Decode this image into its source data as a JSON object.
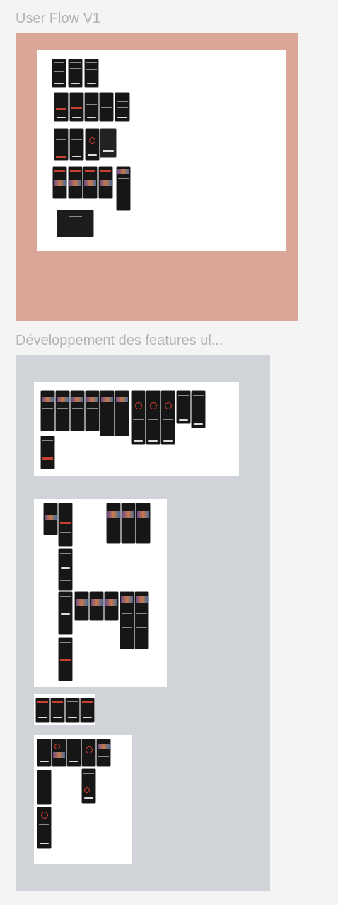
{
  "sections": [
    {
      "id": "user-flow",
      "title": "User Flow V1",
      "background": "#d9a698"
    },
    {
      "id": "dev-features",
      "title": "Développement des features ul...",
      "background": "#d0d4d8"
    },
    {
      "id": "partial",
      "title": ""
    }
  ],
  "colors": {
    "canvas": "#f4f4f4",
    "board": "#ffffff",
    "screen": "#161616",
    "accent": "#c8402e",
    "title": "#b3b3b3"
  }
}
